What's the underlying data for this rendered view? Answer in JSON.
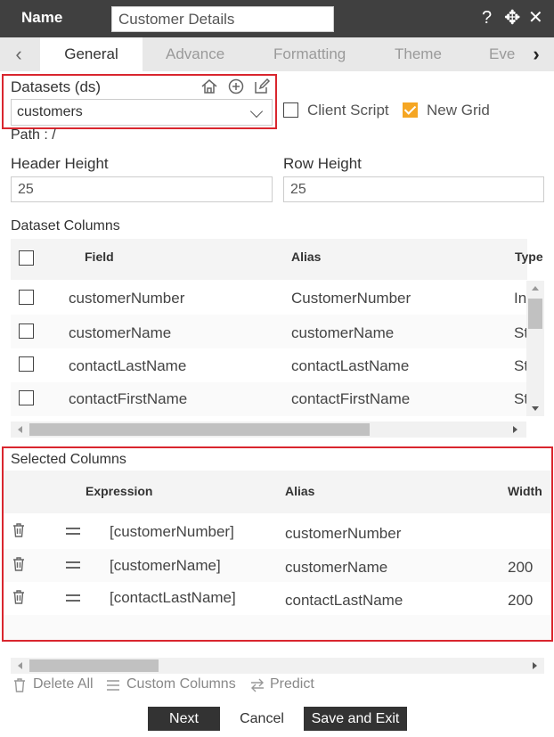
{
  "header": {
    "name_label": "Name",
    "name_value": "Customer Details",
    "help": "?",
    "move": "✥",
    "close": "✕"
  },
  "tabs": {
    "prev": "‹",
    "next": "›",
    "items": [
      {
        "label": "General"
      },
      {
        "label": "Advance"
      },
      {
        "label": "Formatting"
      },
      {
        "label": "Theme"
      },
      {
        "label": "Eve"
      }
    ]
  },
  "dataset": {
    "label": "Datasets (ds)",
    "selected": "customers",
    "path": "Path : /",
    "client_script": "Client Script",
    "client_script_checked": false,
    "new_grid": "New Grid",
    "new_grid_checked": true
  },
  "heights": {
    "header_label": "Header Height",
    "header_value": "25",
    "row_label": "Row Height",
    "row_value": "25"
  },
  "dataset_columns": {
    "title": "Dataset Columns",
    "headers": {
      "field": "Field",
      "alias": "Alias",
      "type": "Type"
    },
    "rows": [
      {
        "field": "customerNumber",
        "alias": "CustomerNumber",
        "type": "In"
      },
      {
        "field": "customerName",
        "alias": "customerName",
        "type": "St"
      },
      {
        "field": "contactLastName",
        "alias": "contactLastName",
        "type": "St"
      },
      {
        "field": "contactFirstName",
        "alias": "contactFirstName",
        "type": "St"
      }
    ]
  },
  "selected_columns": {
    "title": "Selected Columns",
    "headers": {
      "expression": "Expression",
      "alias": "Alias",
      "width": "Width"
    },
    "rows": [
      {
        "expression": "[customerNumber]",
        "alias": "customerNumber",
        "width": ""
      },
      {
        "expression": "[customerName]",
        "alias": "customerName",
        "width": "200"
      },
      {
        "expression": "[contactLastName]",
        "alias": "contactLastName",
        "width": "200"
      }
    ]
  },
  "tools": {
    "delete_all": "Delete All",
    "custom_columns": "Custom Columns",
    "predict": "Predict"
  },
  "buttons": {
    "next": "Next",
    "cancel": "Cancel",
    "save_exit": "Save and Exit"
  },
  "colors": {
    "header_bg": "#404040",
    "accent_checkbox": "#f5a623",
    "highlight_border": "#d9262e"
  }
}
